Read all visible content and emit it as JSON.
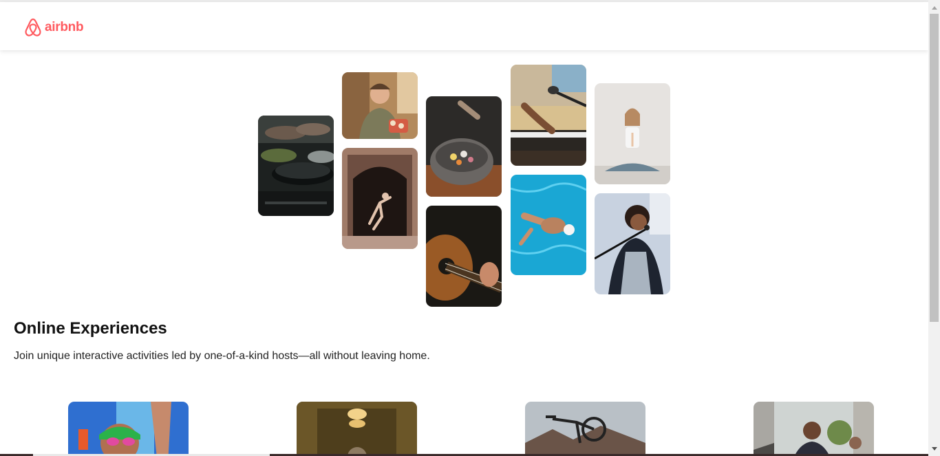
{
  "header": {
    "logo_text": "airbnb",
    "logo_icon": "airbnb-belo-icon",
    "brand_color": "#ff5a5f"
  },
  "hero": {
    "photos": [
      "cooking-pans-photo",
      "woman-holding-food-photo",
      "dancer-in-doorway-photo",
      "gourmet-bowl-photo",
      "acoustic-guitar-photo",
      "piano-microphone-photo",
      "swimmer-pool-photo",
      "yoga-meditation-photo",
      "singer-microphone-photo"
    ]
  },
  "section": {
    "title": "Online Experiences",
    "description": "Join unique interactive activities led by one-of-a-kind hosts—all without leaving home."
  },
  "cards": [
    "swimmer-goggles-card",
    "chandelier-hall-card",
    "bicycle-mountain-card",
    "man-city-street-card"
  ],
  "scrollbar": {
    "up_icon": "scroll-up-arrow-icon",
    "down_icon": "scroll-down-arrow-icon"
  }
}
